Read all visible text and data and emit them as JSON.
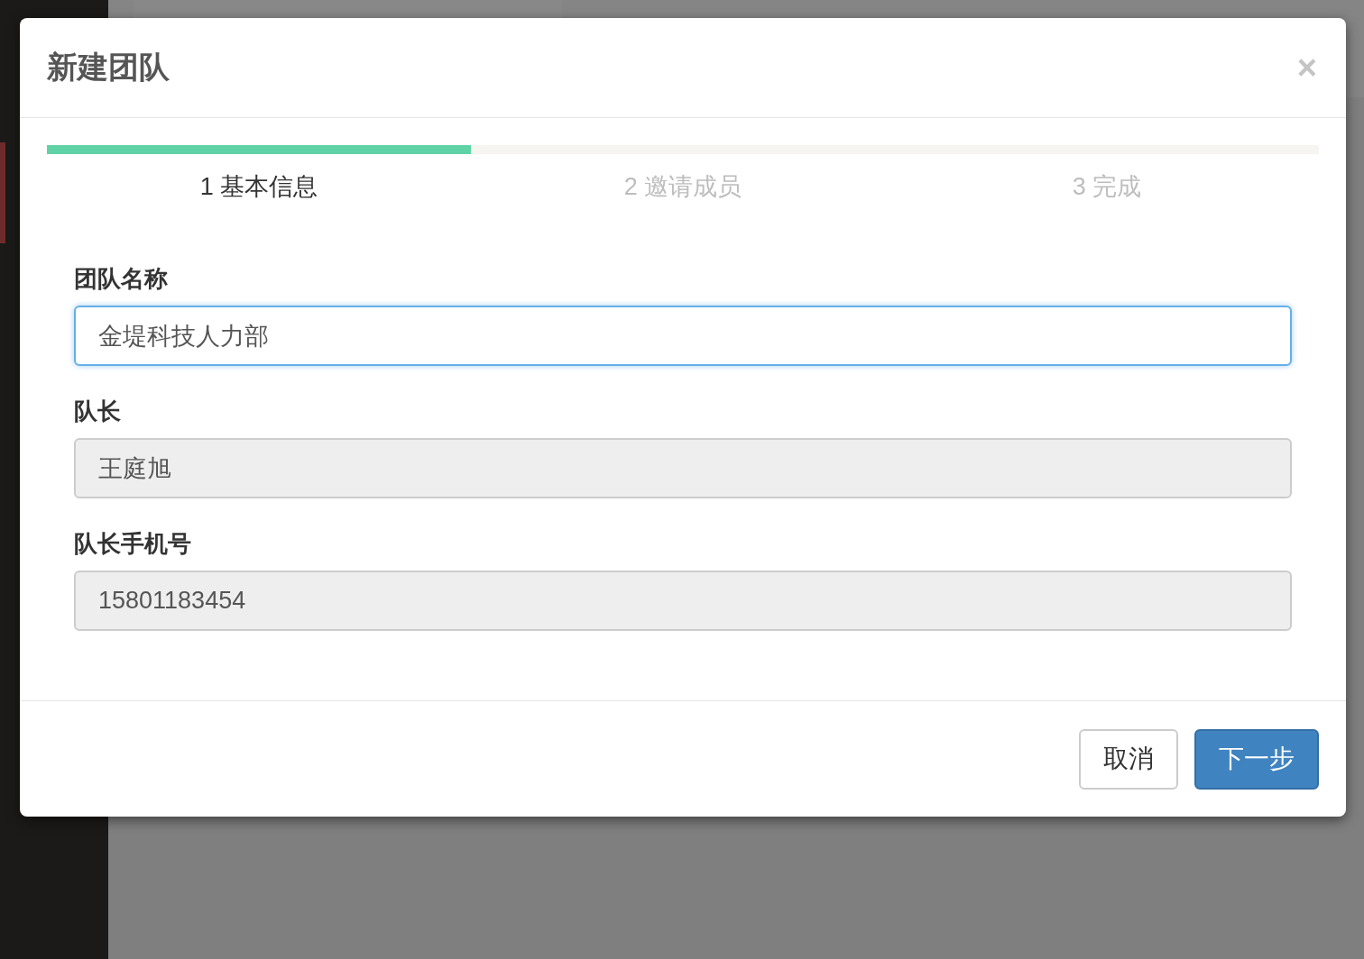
{
  "dialog": {
    "title": "新建团队",
    "close": "×"
  },
  "progress": {
    "level": 0.333
  },
  "steps": [
    {
      "label": "1 基本信息",
      "selected": true
    },
    {
      "label": "2 邀请成员",
      "selected": false
    },
    {
      "label": "3 完成",
      "selected": false
    }
  ],
  "fields": [
    {
      "label": "团队名称",
      "value": "金堤科技人力部",
      "focused": true,
      "disabled": false
    },
    {
      "label": "队长",
      "value": "王庭旭",
      "focused": false,
      "disabled": true
    },
    {
      "label": "队长手机号",
      "value": "15801183454",
      "focused": false,
      "disabled": true
    }
  ],
  "buttons": [
    {
      "label": "取消",
      "kind": "default"
    },
    {
      "label": "下一步",
      "kind": "primary"
    }
  ]
}
